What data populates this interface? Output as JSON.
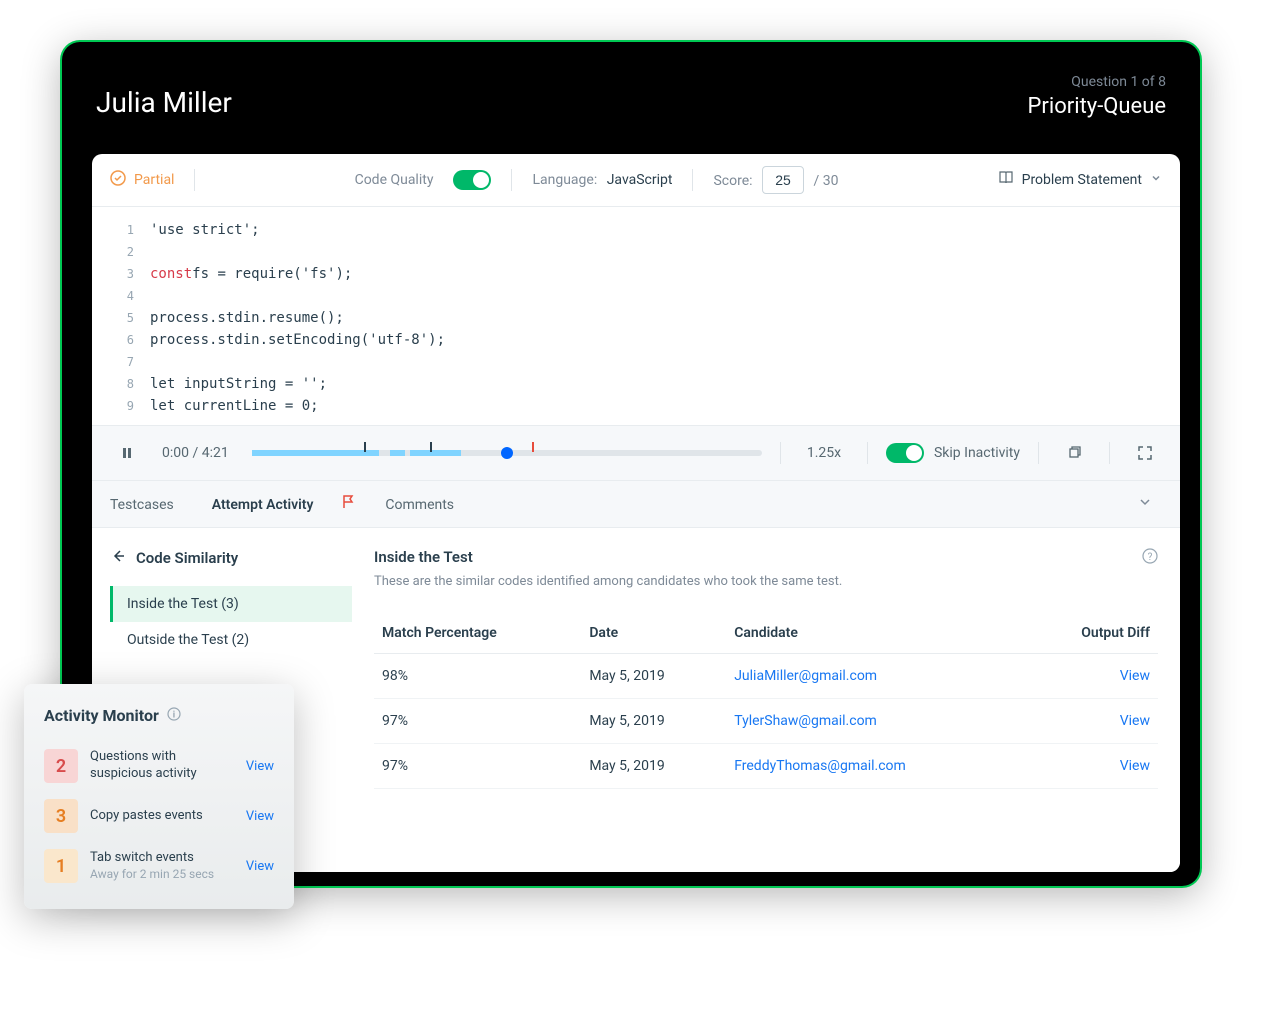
{
  "header": {
    "candidate": "Julia Miller",
    "question_counter": "Question 1 of 8",
    "question_title": "Priority-Queue"
  },
  "toolbar": {
    "status": "Partial",
    "code_quality_label": "Code Quality",
    "language_label": "Language:",
    "language_value": "JavaScript",
    "score_label": "Score:",
    "score_value": "25",
    "score_max": "/ 30",
    "problem_statement": "Problem Statement"
  },
  "code": {
    "lines": [
      {
        "n": "1",
        "t": "'use strict';"
      },
      {
        "n": "2",
        "t": ""
      },
      {
        "n": "3",
        "kw": "const",
        "rest": " fs = require('fs');"
      },
      {
        "n": "4",
        "t": ""
      },
      {
        "n": "5",
        "t": "process.stdin.resume();"
      },
      {
        "n": "6",
        "t": "process.stdin.setEncoding('utf-8');"
      },
      {
        "n": "7",
        "t": ""
      },
      {
        "n": "8",
        "t": "let inputString = '';"
      },
      {
        "n": "9",
        "t": "let currentLine = 0;"
      }
    ]
  },
  "playback": {
    "time": "0:00 / 4:21",
    "speed": "1.25x",
    "skip_label": "Skip Inactivity"
  },
  "tabs": {
    "testcases": "Testcases",
    "attempt": "Attempt Activity",
    "comments": "Comments"
  },
  "similarity": {
    "title": "Code Similarity",
    "items": [
      {
        "label": "Inside the Test (3)"
      },
      {
        "label": "Outside the Test (2)"
      }
    ],
    "section_title": "Inside the Test",
    "section_desc": "These are the similar codes identified among candidates who took the same test.",
    "columns": {
      "match": "Match Percentage",
      "date": "Date",
      "candidate": "Candidate",
      "diff": "Output Diff"
    },
    "rows": [
      {
        "match": "98%",
        "date": "May 5, 2019",
        "candidate": "JuliaMiller@gmail.com",
        "diff": "View"
      },
      {
        "match": "97%",
        "date": "May 5, 2019",
        "candidate": "TylerShaw@gmail.com",
        "diff": "View"
      },
      {
        "match": "97%",
        "date": "May 5, 2019",
        "candidate": "FreddyThomas@gmail.com",
        "diff": "View"
      }
    ]
  },
  "activity": {
    "title": "Activity Monitor",
    "view": "View",
    "items": [
      {
        "count": "2",
        "label": "Questions with suspicious activity",
        "sub": ""
      },
      {
        "count": "3",
        "label": "Copy pastes events",
        "sub": ""
      },
      {
        "count": "1",
        "label": "Tab switch events",
        "sub": "Away for 2 min 25 secs"
      }
    ]
  }
}
